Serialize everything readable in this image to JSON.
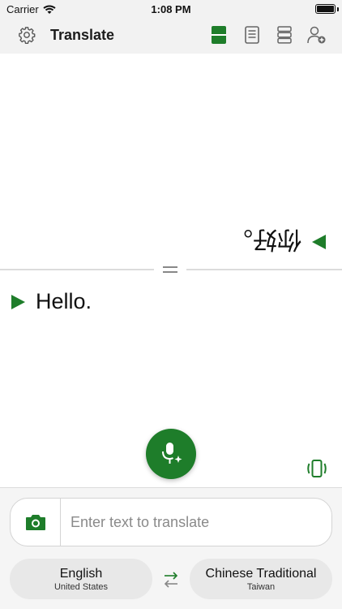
{
  "status_bar": {
    "carrier": "Carrier",
    "time": "1:08 PM"
  },
  "toolbar": {
    "title": "Translate",
    "icons": [
      "settings-gear-icon",
      "split-view-icon",
      "document-icon",
      "list-view-icon",
      "add-user-icon"
    ]
  },
  "conversation": {
    "upper": {
      "text": "你好。",
      "rotated": true,
      "speak_icon": "play-triangle-icon"
    },
    "lower": {
      "text": "Hello.",
      "speak_icon": "play-triangle-icon"
    }
  },
  "input": {
    "placeholder": "Enter text to translate",
    "value": "",
    "camera_icon": "camera-icon"
  },
  "languages": {
    "source": {
      "name": "English",
      "region": "United States"
    },
    "target": {
      "name": "Chinese Traditional",
      "region": "Taiwan"
    },
    "swap_icon": "swap-arrows-icon"
  },
  "colors": {
    "accent": "#1e7d2a",
    "toolbar_bg": "#f2f2f2",
    "bottom_bg": "#f5f5f5",
    "pill_bg": "#e8e8e8"
  }
}
